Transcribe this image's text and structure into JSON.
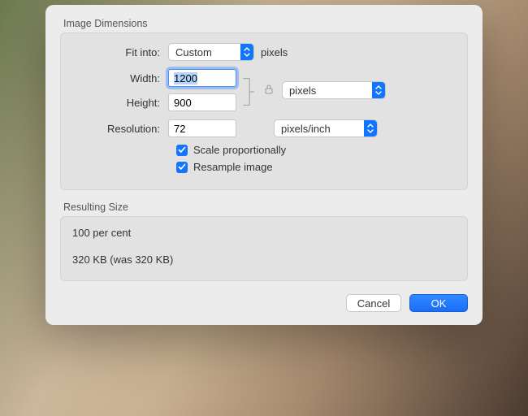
{
  "sections": {
    "dimensions_title": "Image Dimensions",
    "result_title": "Resulting Size"
  },
  "fields": {
    "fit_into_label": "Fit into:",
    "fit_into_value": "Custom",
    "fit_into_unit": "pixels",
    "width_label": "Width:",
    "width_value": "1200",
    "height_label": "Height:",
    "height_value": "900",
    "wh_unit_value": "pixels",
    "resolution_label": "Resolution:",
    "resolution_value": "72",
    "resolution_unit_value": "pixels/inch"
  },
  "checkboxes": {
    "scale_label": "Scale proportionally",
    "scale_checked": true,
    "resample_label": "Resample image",
    "resample_checked": true
  },
  "result": {
    "percent_line": "100 per cent",
    "size_line": "320 KB (was 320 KB)"
  },
  "buttons": {
    "cancel": "Cancel",
    "ok": "OK"
  }
}
